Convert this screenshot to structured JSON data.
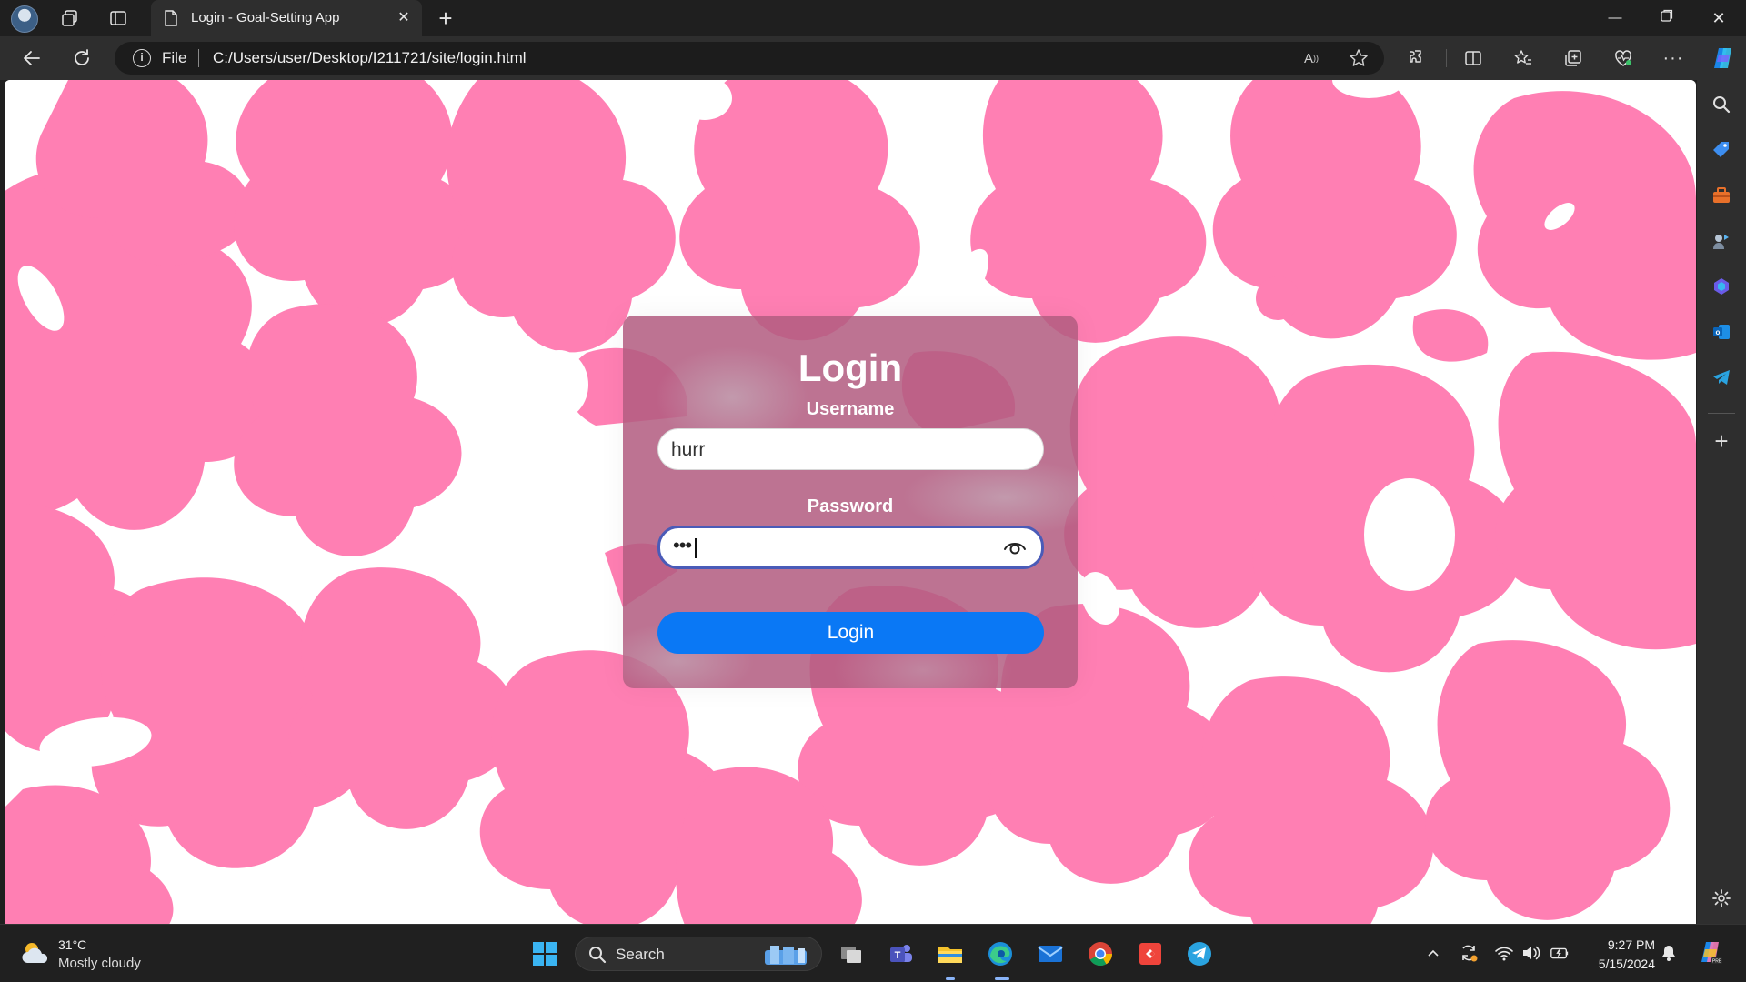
{
  "browser": {
    "tab_title": "Login - Goal-Setting App",
    "address_scheme": "File",
    "address_url": "C:/Users/user/Desktop/I211721/site/login.html"
  },
  "page": {
    "title": "Login",
    "username_label": "Username",
    "username_value": "hurr",
    "password_label": "Password",
    "password_mask": "•••",
    "login_button": "Login",
    "colors": {
      "accent": "#0a78f5",
      "card": "#b25c80",
      "flowers": "#ff7fb3"
    }
  },
  "taskbar": {
    "weather_temp": "31°C",
    "weather_desc": "Mostly cloudy",
    "search_label": "Search",
    "time": "9:27 PM",
    "date": "5/15/2024"
  },
  "icons": {
    "titlebar": [
      "profile-avatar",
      "workspaces-icon",
      "tab-actions-icon",
      "page-icon",
      "close-icon",
      "new-tab-icon"
    ],
    "toolbar": [
      "back-icon",
      "refresh-icon",
      "read-aloud-icon",
      "favorite-star-icon",
      "extensions-icon",
      "split-screen-icon",
      "favorites-icon",
      "collections-icon",
      "browser-essentials-icon",
      "more-icon",
      "copilot-icon"
    ],
    "sidebar": [
      "search-icon",
      "shopping-icon",
      "tools-icon",
      "games-icon",
      "microsoft-365-icon",
      "outlook-icon",
      "telegram-icon",
      "add-icon",
      "settings-icon"
    ],
    "taskbar": [
      "windows-start-icon",
      "task-view-icon",
      "teams-icon",
      "file-explorer-icon",
      "edge-icon",
      "mail-icon",
      "chrome-icon",
      "anydesk-icon",
      "telegram-icon"
    ]
  }
}
